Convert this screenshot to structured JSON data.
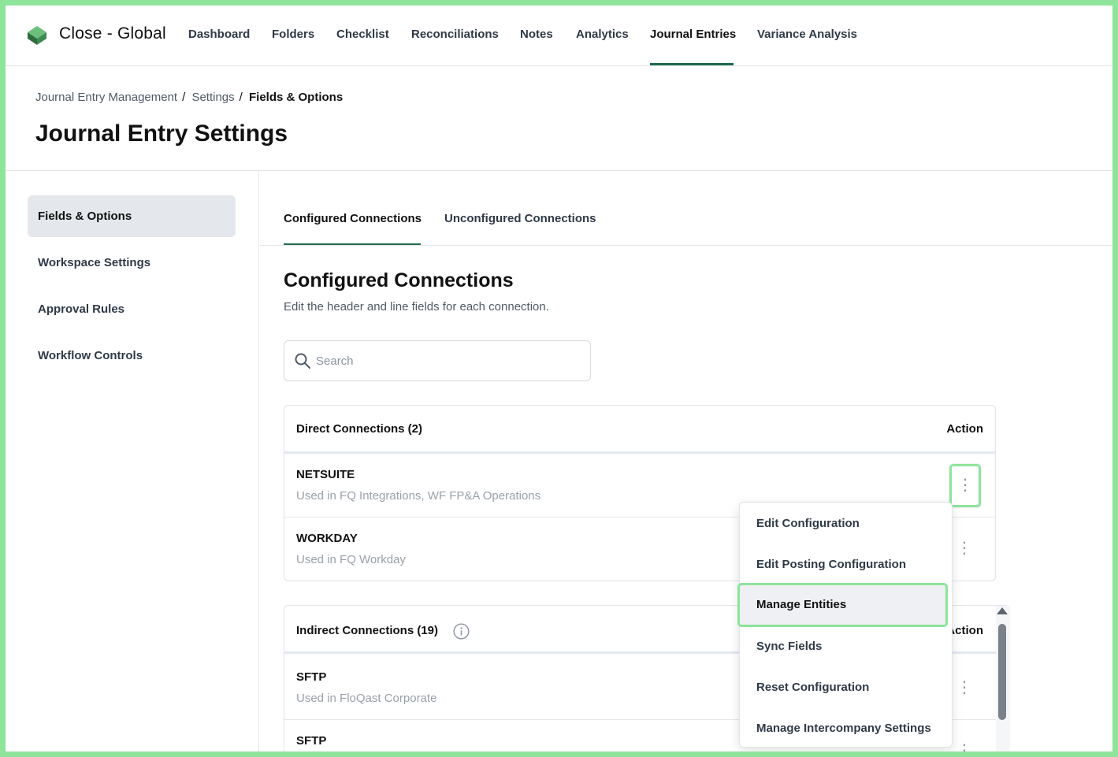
{
  "app": {
    "brand": "Close - Global",
    "nav": [
      {
        "label": "Dashboard"
      },
      {
        "label": "Folders"
      },
      {
        "label": "Checklist"
      },
      {
        "label": "Reconciliations"
      },
      {
        "label": "Notes"
      },
      {
        "label": "Analytics"
      },
      {
        "label": "Journal Entries",
        "active": true
      },
      {
        "label": "Variance Analysis"
      }
    ],
    "accent": "#1e6b4b",
    "highlight": "#8ee49a"
  },
  "breadcrumb": [
    "Journal Entry Management",
    "Settings",
    "Fields & Options"
  ],
  "breadcrumb_sep": "/",
  "page_title": "Journal Entry Settings",
  "sidebar": {
    "items": [
      {
        "label": "Fields & Options",
        "active": true
      },
      {
        "label": "Workspace Settings"
      },
      {
        "label": "Approval Rules"
      },
      {
        "label": "Workflow Controls"
      }
    ]
  },
  "tabs": [
    {
      "label": "Configured Connections",
      "active": true
    },
    {
      "label": "Unconfigured Connections"
    }
  ],
  "section": {
    "title": "Configured Connections",
    "subtitle": "Edit the header and line fields for each connection."
  },
  "search": {
    "placeholder": "Search",
    "value": ""
  },
  "direct": {
    "header": "Direct Connections (2)",
    "action": "Action",
    "rows": [
      {
        "title": "NETSUITE",
        "sub": "Used in FQ Integrations, WF FP&A Operations"
      },
      {
        "title": "WORKDAY",
        "sub": "Used in FQ Workday"
      }
    ]
  },
  "indirect": {
    "header": "Indirect Connections (19)",
    "action": "Action",
    "rows": [
      {
        "title": "SFTP",
        "sub": "Used in FloQast Corporate"
      },
      {
        "title": "SFTP",
        "sub": ""
      }
    ]
  },
  "menu": {
    "items": [
      {
        "label": "Edit Configuration"
      },
      {
        "label": "Edit Posting Configuration"
      },
      {
        "label": "Manage Entities",
        "highlighted": true
      },
      {
        "label": "Sync Fields"
      },
      {
        "label": "Reset Configuration"
      },
      {
        "label": "Manage Intercompany Settings"
      }
    ]
  },
  "icons": {
    "logo": "floqast-logo-icon",
    "search": "search-icon",
    "info": "info-icon",
    "kebab": "kebab-menu-icon"
  }
}
